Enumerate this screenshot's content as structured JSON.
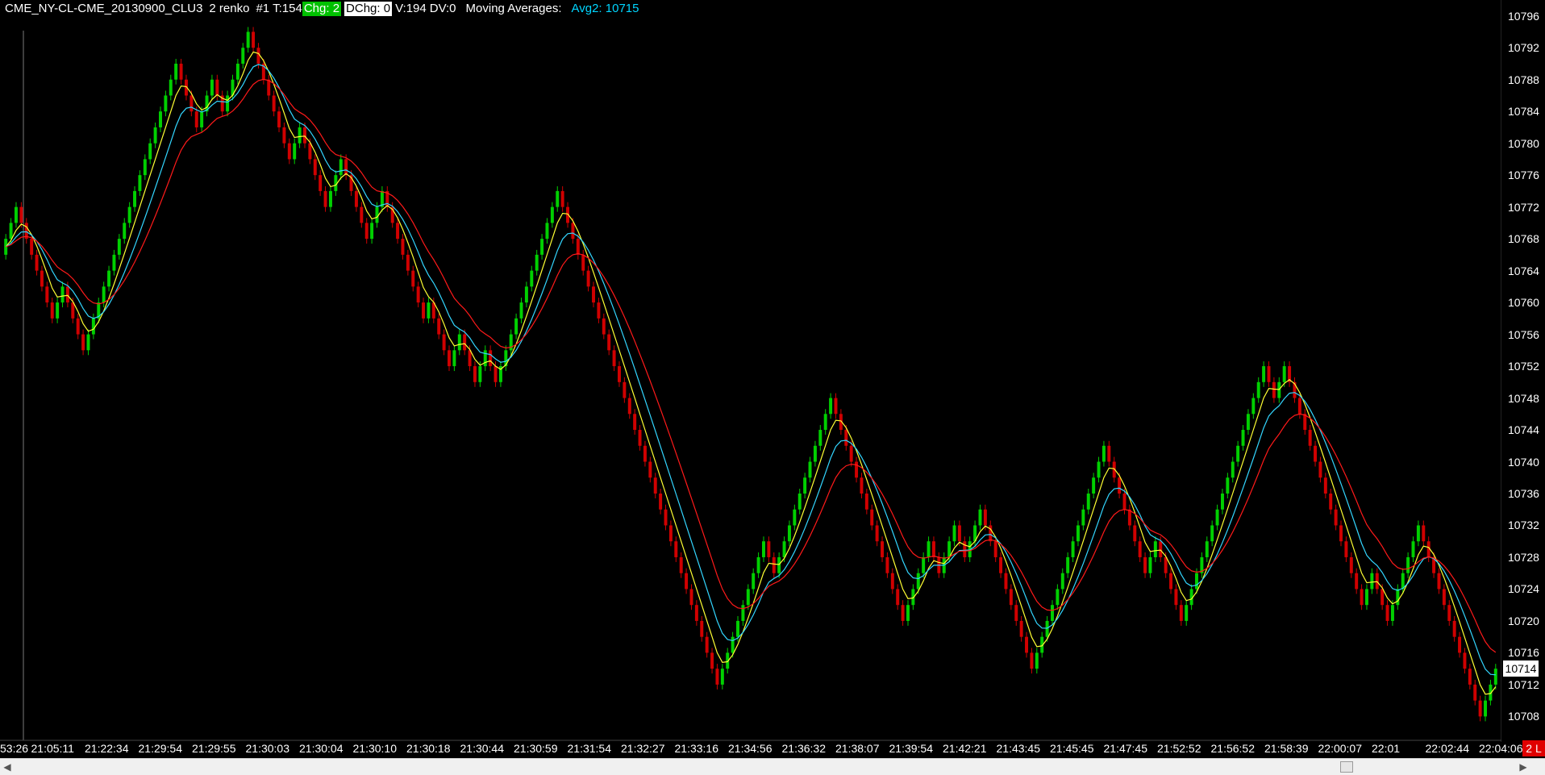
{
  "header": {
    "symbol": "CME_NY-CL-CME_20130900_CLU3",
    "bar_type": "2 renko",
    "chart_num": "#1",
    "ticks": "T:154",
    "chg": "Chg: 2",
    "dchg": "DChg: 0",
    "volume": "V:194",
    "dv": "DV:0",
    "studies_label": "Moving Averages:",
    "avg2": "Avg2: 10715"
  },
  "colors": {
    "up": "#00d000",
    "down": "#d00000",
    "ma_yellow": "#ffff33",
    "ma_cyan": "#33d6ff",
    "ma_red": "#ff1a1a",
    "background": "#000000",
    "avg_label": "#00d5ff"
  },
  "price_tag": "10714",
  "mode_badge": "2 L",
  "chart_data": {
    "type": "line",
    "y_range": [
      10705,
      10798
    ],
    "y_ticks": [
      10708,
      10712,
      10716,
      10720,
      10724,
      10728,
      10732,
      10736,
      10740,
      10744,
      10748,
      10752,
      10756,
      10760,
      10764,
      10768,
      10772,
      10776,
      10780,
      10784,
      10788,
      10792,
      10796
    ],
    "x_labels": [
      "53:26",
      "21:05:11",
      "21:22:34",
      "21:29:54",
      "21:29:55",
      "21:30:03",
      "21:30:04",
      "21:30:10",
      "21:30:18",
      "21:30:44",
      "21:30:59",
      "21:31:54",
      "21:32:27",
      "21:33:16",
      "21:34:56",
      "21:36:32",
      "21:38:07",
      "21:39:54",
      "21:42:21",
      "21:43:45",
      "21:45:45",
      "21:47:45",
      "21:52:52",
      "21:56:52",
      "21:58:39",
      "22:00:07",
      "22:01",
      "22:02:44",
      "22:04:06"
    ],
    "price_path": [
      10766,
      10772,
      10764,
      10758,
      10762,
      10754,
      10762,
      10772,
      10778,
      10790,
      10782,
      10788,
      10784,
      10794,
      10786,
      10778,
      10782,
      10772,
      10778,
      10768,
      10774,
      10762,
      10758,
      10760,
      10752,
      10756,
      10750,
      10754,
      10750,
      10756,
      10762,
      10772,
      10774,
      10764,
      10758,
      10750,
      10740,
      10728,
      10718,
      10712,
      10718,
      10730,
      10726,
      10736,
      10744,
      10748,
      10740,
      10734,
      10728,
      10720,
      10730,
      10726,
      10732,
      10728,
      10734,
      10724,
      10718,
      10714,
      10720,
      10728,
      10734,
      10742,
      10736,
      10732,
      10726,
      10730,
      10720,
      10724,
      10730,
      10738,
      10744,
      10752,
      10748,
      10752,
      10744,
      10734,
      10728,
      10722,
      10726,
      10720,
      10728,
      10732,
      10726,
      10720,
      10712,
      10708,
      10714
    ],
    "series": []
  }
}
